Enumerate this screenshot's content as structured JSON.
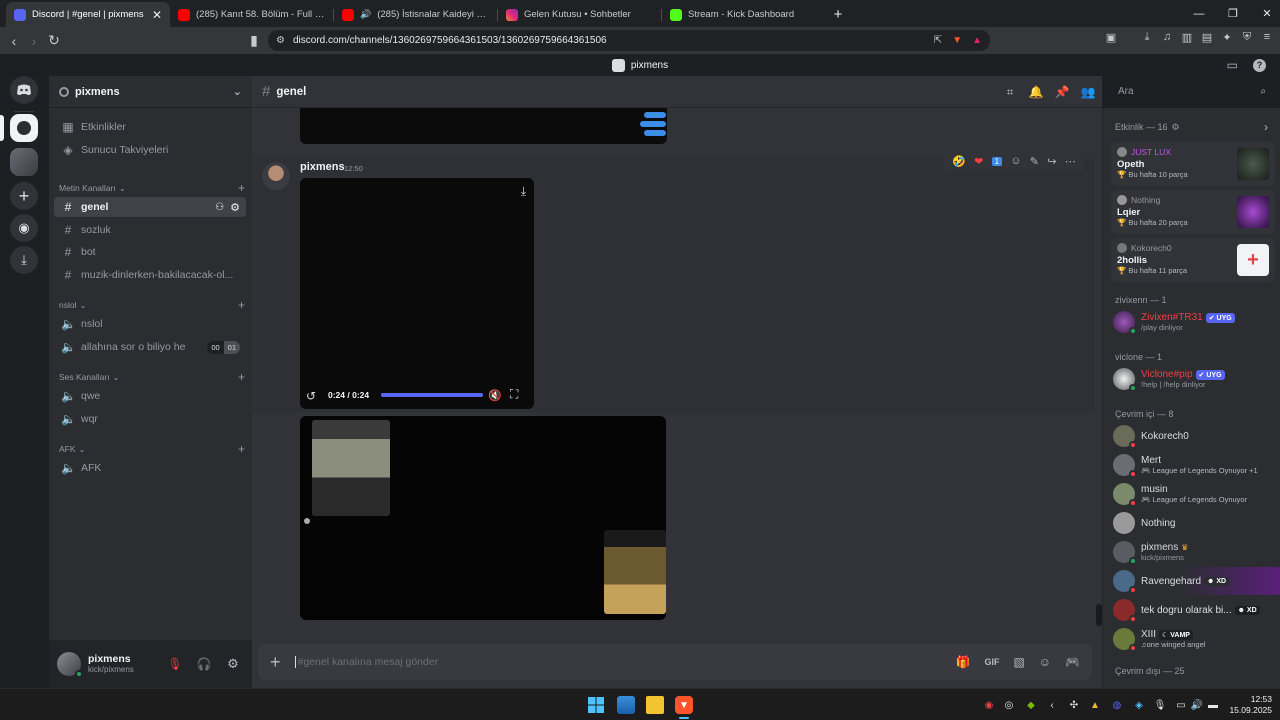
{
  "browser": {
    "tabs": [
      {
        "title": "Discord | #genel | pixmens",
        "color": "#5865f2",
        "active": true
      },
      {
        "title": "(285) Kanıt 58. Bölüm - Full Bölüm - \\",
        "color": "#ff0000"
      },
      {
        "title": "(285) İstisnalar Kaideyi Bozmaz -",
        "color": "#ff0000"
      },
      {
        "title": "Gelen Kutusu • Sohbetler",
        "color": "#dd2a7b"
      },
      {
        "title": "Stream - Kick Dashboard",
        "color": "#53fc18"
      }
    ],
    "url": "discord.com/channels/1360269759664361503/1360269759664361506"
  },
  "discord": {
    "window_title": "pixmens",
    "server_name": "pixmens",
    "top_items": [
      "Etkinlikler",
      "Sunucu Takviyeleri"
    ],
    "categories": [
      {
        "name": "Metin Kanalları",
        "channels": [
          "genel",
          "sozluk",
          "bot",
          "muzik-dinlerken-bakilacacak-ol..."
        ]
      },
      {
        "name": "nslol",
        "channels": [
          "nslol",
          "allahına sor o biliyo he"
        ]
      },
      {
        "name": "Ses Kanalları",
        "channels": [
          "qwe",
          "wqr"
        ]
      },
      {
        "name": "AFK",
        "channels": [
          "AFK"
        ]
      }
    ],
    "voice_timer": [
      "00",
      "01"
    ],
    "current_channel": "genel",
    "search_placeholder": "Ara",
    "user": {
      "name": "pixmens",
      "status": "kick/pixmens"
    },
    "message": {
      "author": "pixmens",
      "time": "12:50",
      "video_time": "0:24 / 0:24",
      "video_progress": 1.0
    },
    "composer_placeholder": "#genel kanalına mesaj gönder",
    "activity_header": "Etkinlik — 16",
    "activities": [
      {
        "user": "JUST LUX",
        "title": "Opeth",
        "sub": "Bu hafta 10 parça",
        "accent": "#c157e6"
      },
      {
        "user": "Nothing",
        "title": "Lqier",
        "sub": "Bu hafta 20 parça",
        "accent": "#a64bd1"
      },
      {
        "user": "Kokorech0",
        "title": "2hollis",
        "sub": "Bu hafta 11 parça",
        "accent": "#e0474c"
      }
    ],
    "member_groups": [
      {
        "title": "zivixenn — 1",
        "members": [
          {
            "name": "Zivixen#TR31",
            "badge": "UYG",
            "sub": "/play dinliyor",
            "color": "#f23f43"
          }
        ]
      },
      {
        "title": "viclone — 1",
        "members": [
          {
            "name": "Viclone#pip",
            "badge": "UYG",
            "sub": "!help | /help dinliyor",
            "color": "#f23f43"
          }
        ]
      },
      {
        "title": "Çevrim içi — 8",
        "members": [
          {
            "name": "Kokorech0",
            "sub": "",
            "color": "#dbdee1"
          },
          {
            "name": "Mert",
            "sub": "League of Legends Oynuyor +1",
            "color": "#dbdee1"
          },
          {
            "name": "musin",
            "sub": "League of Legends Oynuyor",
            "color": "#dbdee1"
          },
          {
            "name": "Nothing",
            "sub": "",
            "color": "#dbdee1"
          },
          {
            "name": "pixmens",
            "sub": "kick/pixmens",
            "color": "#dbdee1"
          },
          {
            "name": "Ravengehard",
            "badge": "XD",
            "sub": "",
            "color": "#dbdee1"
          },
          {
            "name": "tek dogru olarak bi...",
            "badge": "XD",
            "sub": "",
            "color": "#dbdee1"
          },
          {
            "name": "XIII",
            "badge": "VAMP",
            "sub": "one winged angel",
            "color": "#dbdee1"
          }
        ]
      },
      {
        "title": "Çevrim dışı — 25",
        "members": []
      }
    ]
  },
  "taskbar": {
    "time": "12:53",
    "date": "15.09.2025"
  }
}
